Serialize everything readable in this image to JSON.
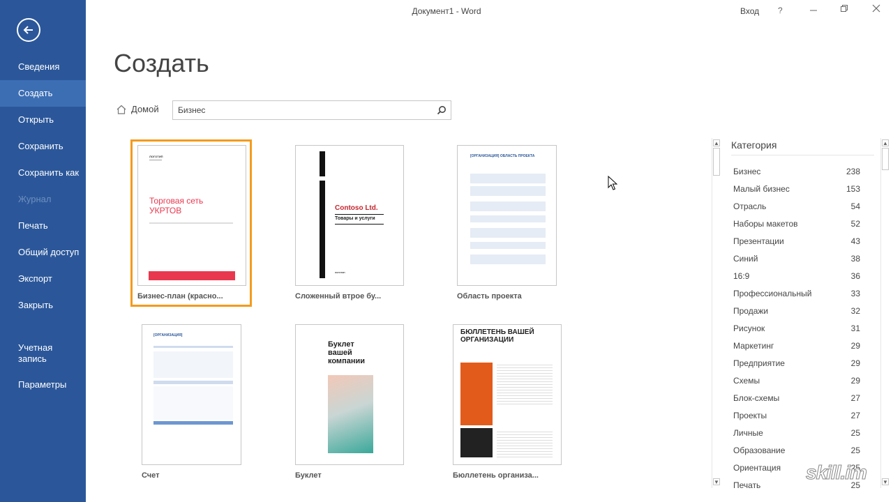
{
  "window": {
    "title": "Документ1 - Word",
    "signin_label": "Вход",
    "help_label": "?"
  },
  "sidebar": {
    "items": [
      {
        "label": "Сведения"
      },
      {
        "label": "Создать"
      },
      {
        "label": "Открыть"
      },
      {
        "label": "Сохранить"
      },
      {
        "label": "Сохранить как"
      },
      {
        "label": "Журнал"
      },
      {
        "label": "Печать"
      },
      {
        "label": "Общий доступ"
      },
      {
        "label": "Экспорт"
      },
      {
        "label": "Закрыть"
      },
      {
        "label": "Учетная запись"
      },
      {
        "label": "Параметры"
      }
    ]
  },
  "main": {
    "title": "Создать",
    "home_label": "Домой",
    "search_value": "Бизнес"
  },
  "templates": [
    {
      "label": "Бизнес-план (красно...",
      "preview_title": "Торговая сеть УКРТОВ",
      "preview_logo": "ЛОГОТИП"
    },
    {
      "label": "Сложенный втрое бу...",
      "preview_title": "Contoso Ltd.",
      "preview_subtitle": "Товары и услуги",
      "preview_logo": "ЛОГОТИП"
    },
    {
      "label": "Область проекта",
      "preview_title": "[ОРГАНИЗАЦИЯ] ОБЛАСТЬ ПРОЕКТА"
    },
    {
      "label": "Счет",
      "preview_title": "[ОРГАНИЗАЦИЯ]"
    },
    {
      "label": "Буклет",
      "preview_title": "Буклет вашей компании"
    },
    {
      "label": "Бюллетень организа...",
      "preview_title": "БЮЛЛЕТЕНЬ ВАШЕЙ ОРГАНИЗАЦИИ"
    }
  ],
  "categories": {
    "header": "Категория",
    "items": [
      {
        "name": "Бизнес",
        "count": "238"
      },
      {
        "name": "Малый бизнес",
        "count": "153"
      },
      {
        "name": "Отрасль",
        "count": "54"
      },
      {
        "name": "Наборы макетов",
        "count": "52"
      },
      {
        "name": "Презентации",
        "count": "43"
      },
      {
        "name": "Синий",
        "count": "38"
      },
      {
        "name": "16:9",
        "count": "36"
      },
      {
        "name": "Профессиональный",
        "count": "33"
      },
      {
        "name": "Продажи",
        "count": "32"
      },
      {
        "name": "Рисунок",
        "count": "31"
      },
      {
        "name": "Маркетинг",
        "count": "29"
      },
      {
        "name": "Предприятие",
        "count": "29"
      },
      {
        "name": "Схемы",
        "count": "29"
      },
      {
        "name": "Блок-схемы",
        "count": "27"
      },
      {
        "name": "Проекты",
        "count": "27"
      },
      {
        "name": "Личные",
        "count": "25"
      },
      {
        "name": "Образование",
        "count": "25"
      },
      {
        "name": "Ориентация",
        "count": "25"
      },
      {
        "name": "Печать",
        "count": "25"
      }
    ]
  },
  "watermark": "skill.im",
  "colors": {
    "sidebar_bg": "#2b579a",
    "sidebar_active": "#3c6eb4",
    "selection": "#f49b1c",
    "business_plan_band": "#e8384f",
    "bulletin_orange": "#e25b1a"
  }
}
